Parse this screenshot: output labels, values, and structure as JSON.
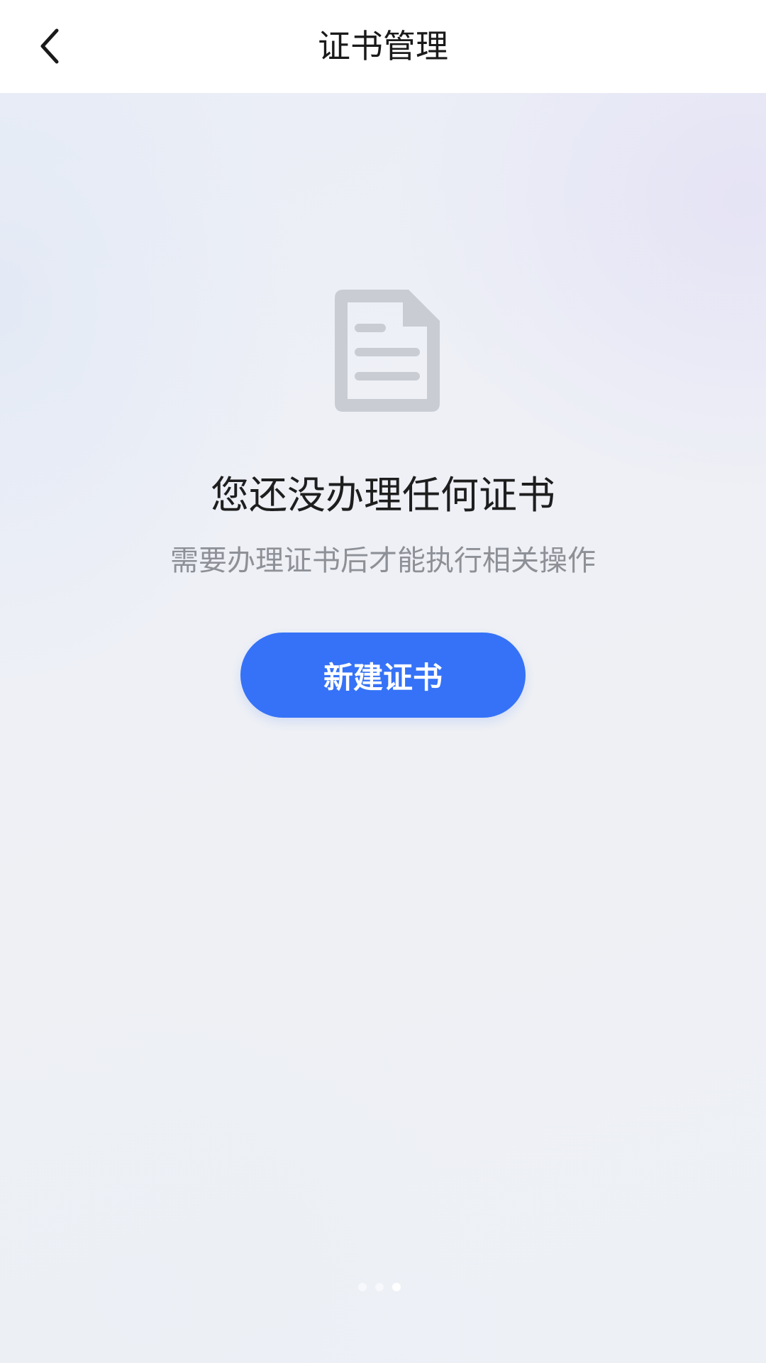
{
  "header": {
    "title": "证书管理",
    "back_icon": "chevron-left-icon"
  },
  "empty_state": {
    "icon": "document-icon",
    "title": "您还没办理任何证书",
    "subtitle": "需要办理证书后才能执行相关操作",
    "button_label": "新建证书"
  },
  "pager": {
    "count": 3,
    "active_index": 3
  },
  "colors": {
    "accent": "#3572F7",
    "icon_gray": "#C9CCD2",
    "title_text": "#1E1E1E",
    "subtitle_text": "#8E9097"
  }
}
